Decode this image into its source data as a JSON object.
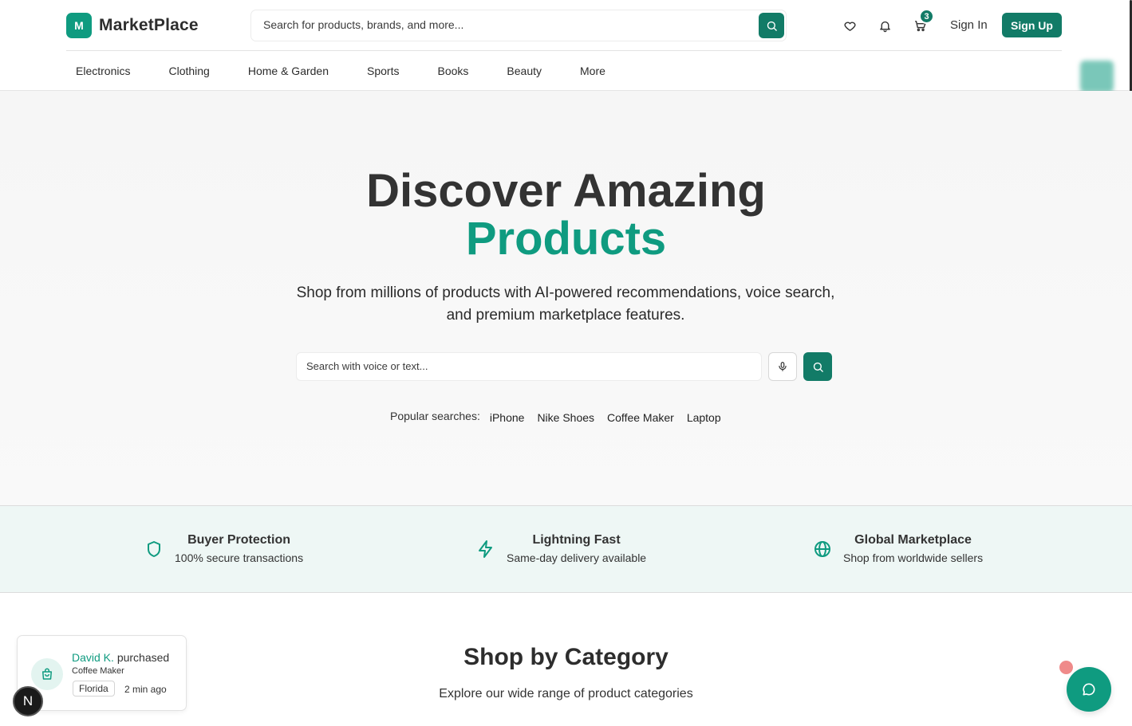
{
  "brand": {
    "logo_letter": "M",
    "name": "MarketPlace",
    "accent_color": "#0f9b80",
    "dark_accent_color": "#127b67"
  },
  "header": {
    "search_placeholder": "Search for products, brands, and more...",
    "cart_count": "3",
    "signin_label": "Sign In",
    "signup_label": "Sign Up"
  },
  "nav": {
    "items": [
      "Electronics",
      "Clothing",
      "Home & Garden",
      "Sports",
      "Books",
      "Beauty",
      "More"
    ]
  },
  "hero": {
    "title_line1": "Discover Amazing",
    "title_line2": "Products",
    "subtitle": "Shop from millions of products with AI-powered recommendations, voice search, and premium marketplace features.",
    "search_placeholder": "Search with voice or text...",
    "popular_label": "Popular searches:",
    "popular_items": [
      "iPhone",
      "Nike Shoes",
      "Coffee Maker",
      "Laptop"
    ]
  },
  "features": [
    {
      "icon": "shield-icon",
      "title": "Buyer Protection",
      "desc": "100% secure transactions"
    },
    {
      "icon": "lightning-icon",
      "title": "Lightning Fast",
      "desc": "Same-day delivery available"
    },
    {
      "icon": "globe-icon",
      "title": "Global Marketplace",
      "desc": "Shop from worldwide sellers"
    }
  ],
  "category": {
    "title": "Shop by Category",
    "subtitle": "Explore our wide range of product categories"
  },
  "toast": {
    "name": "David K.",
    "action": "purchased",
    "product": "Coffee Maker",
    "location": "Florida",
    "time": "2 min ago"
  },
  "dev_badge": "N"
}
